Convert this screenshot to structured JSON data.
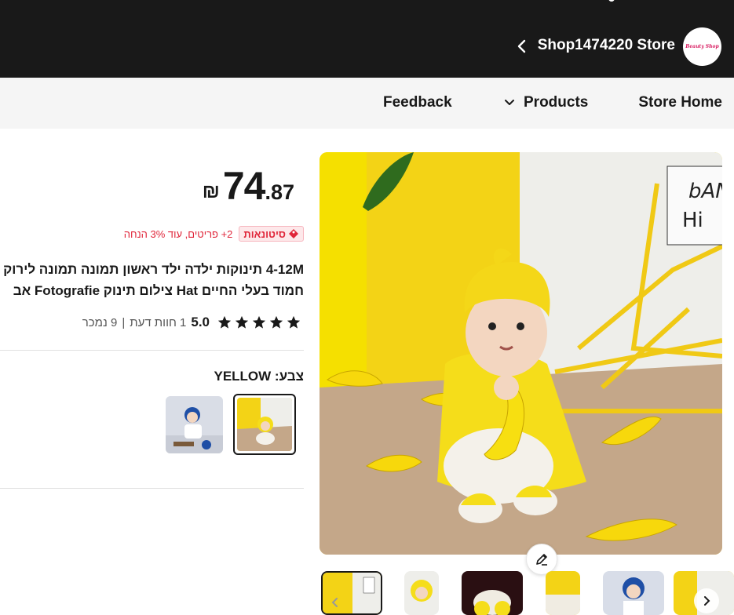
{
  "header": {
    "store_name": "Shop1474220 Store",
    "logo_text": "Beauty Shop"
  },
  "nav": {
    "store_home": "Store Home",
    "products": "Products",
    "feedback": "Feedback"
  },
  "product": {
    "price_currency": "₪",
    "price_integer": "74",
    "price_decimal": ".87",
    "badge_label": "סיטונאות",
    "promo_text": "2+ פריטים, עוד 3% הנחה",
    "title_line1": "4-12M תינוקות ילדה ילד ראשון תמונה תמונה לירוק",
    "title_line2": "חמוד בעלי החיים Hat צילום תינוק Fotografie אב",
    "rating_score": "5.0",
    "reviews": "1 חוות דעת",
    "separator": "|",
    "sold": "9 נמכר",
    "color_label": "צבע: YELLOW"
  },
  "colors": {
    "accent_red": "#e0263a",
    "header_bg": "#191919",
    "banana_yellow": "#f6dd2a"
  },
  "icons": [
    "back-chevron-icon",
    "chevron-down-icon",
    "wholesale-tag-icon",
    "star-icon",
    "edit-pencil-icon",
    "chevron-left-icon",
    "chevron-right-icon"
  ]
}
